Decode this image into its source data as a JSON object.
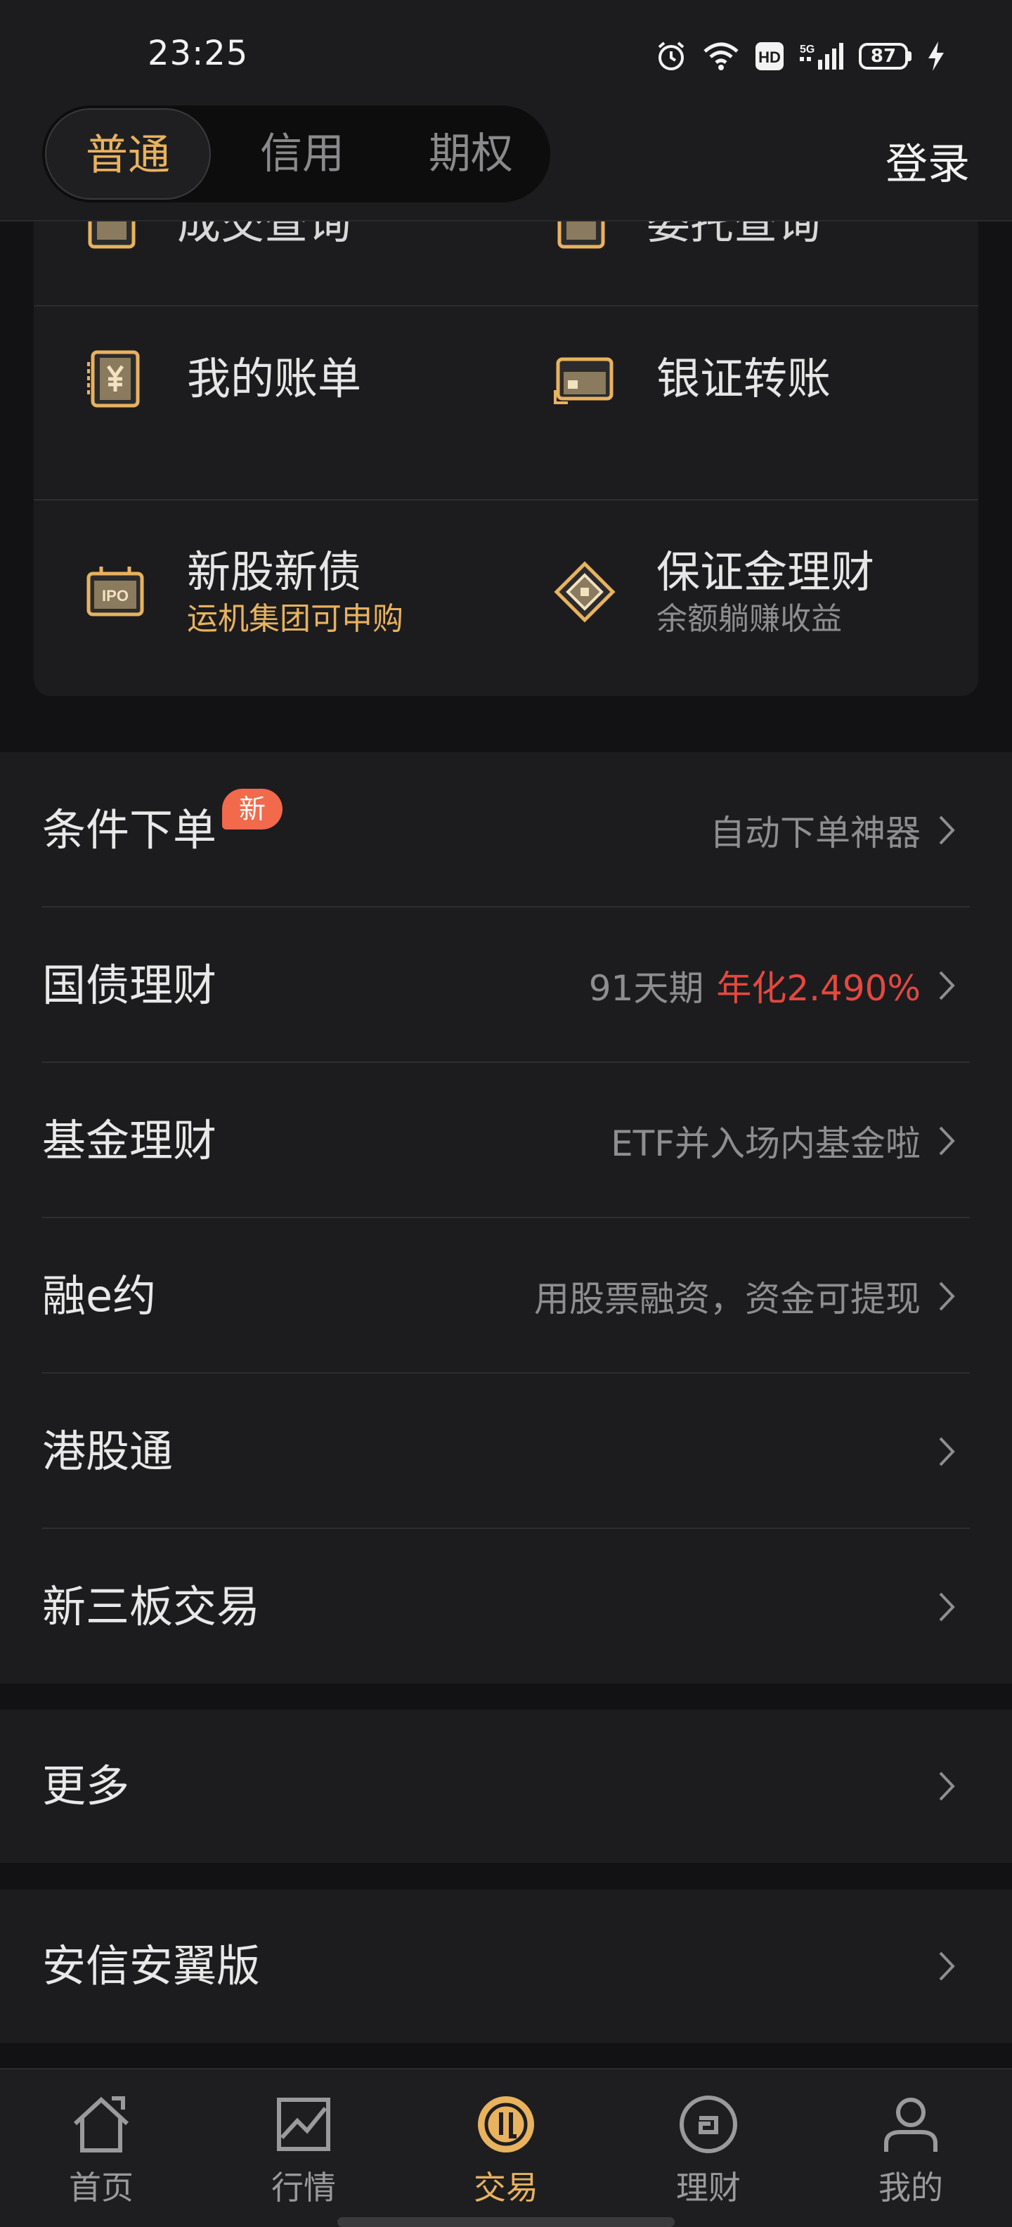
{
  "status_bar": {
    "time": "23:25",
    "battery": "87"
  },
  "header": {
    "tabs": [
      {
        "label": "普通",
        "active": true
      },
      {
        "label": "信用",
        "active": false
      },
      {
        "label": "期权",
        "active": false
      }
    ],
    "login_label": "登录"
  },
  "card": {
    "partial_items": [
      {
        "label": "成交查询",
        "icon": "document-icon"
      },
      {
        "label": "委托查询",
        "icon": "document-icon"
      }
    ],
    "grid": [
      {
        "title": "我的账单",
        "icon": "bill-yuan-icon"
      },
      {
        "title": "银证转账",
        "icon": "bank-card-icon"
      },
      {
        "title": "新股新债",
        "subtitle": "运机集团可申购",
        "subtitle_color": "#e8b25e",
        "icon": "ipo-icon"
      },
      {
        "title": "保证金理财",
        "subtitle": "余额躺赚收益",
        "icon": "diamond-icon"
      }
    ]
  },
  "list": [
    {
      "title": "条件下单",
      "badge": "新",
      "right": "自动下单神器"
    },
    {
      "title": "国债理财",
      "right": "91天期",
      "right_highlight": "年化2.490%"
    },
    {
      "title": "基金理财",
      "right": "ETF并入场内基金啦"
    },
    {
      "title": "融e约",
      "right": "用股票融资，资金可提现"
    },
    {
      "title": "港股通",
      "right": ""
    },
    {
      "title": "新三板交易",
      "right": ""
    }
  ],
  "more": {
    "title": "更多"
  },
  "anxin": {
    "title": "安信安翼版"
  },
  "tabbar": [
    {
      "label": "首页",
      "icon": "home-icon"
    },
    {
      "label": "行情",
      "icon": "chart-icon"
    },
    {
      "label": "交易",
      "icon": "trade-icon",
      "active": true
    },
    {
      "label": "理财",
      "icon": "wealth-icon"
    },
    {
      "label": "我的",
      "icon": "user-icon"
    }
  ],
  "colors": {
    "accent": "#e8b25e",
    "red": "#e5483f",
    "badge": "#f2694b",
    "background": "#1c1c1e"
  }
}
